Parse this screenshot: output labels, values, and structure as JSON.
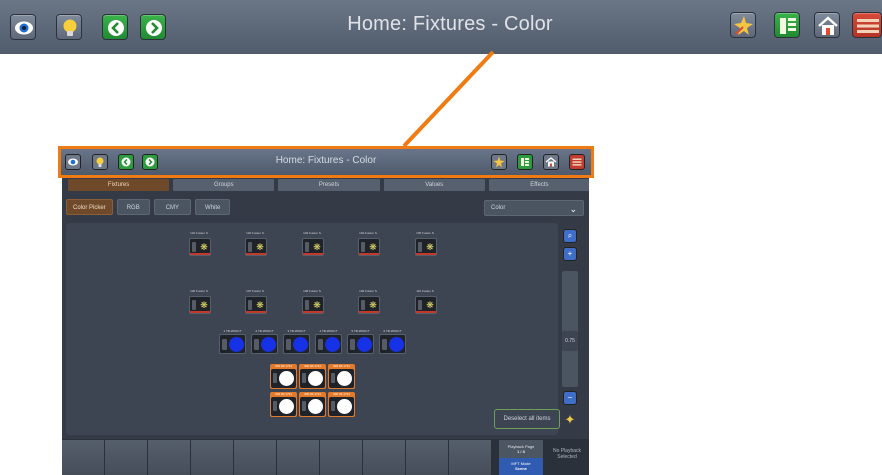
{
  "colors": {
    "accent": "#f07b12",
    "bar": "#5d6879",
    "tab_active": "#6e4a2a",
    "tilebar_dot": "#1732e6"
  },
  "header": {
    "title": "Home: Fixtures - Color",
    "left_icons": [
      "eye-icon",
      "lightbulb-icon",
      "back-arrow-icon",
      "forward-arrow-icon"
    ],
    "right_icons": [
      "sparkle-icon",
      "layout-grid-icon",
      "home-icon",
      "menu-icon"
    ]
  },
  "mini": {
    "title": "Home: Fixtures - Color",
    "tabs": [
      "Fixtures",
      "Groups",
      "Presets",
      "Values",
      "Effects"
    ],
    "active_tab": "Fixtures",
    "subtabs": [
      "Color Picker",
      "RGB",
      "CMY",
      "White"
    ],
    "active_subtab": "Color Picker",
    "dropdown": "Color",
    "fixtures_row1": [
      "101 Fusion S",
      "102 Fusion S",
      "103 Fusion S",
      "104 Fusion S",
      "105 Fusion S"
    ],
    "fixtures_row2": [
      "106 Fusion S",
      "107 Fusion S",
      "108 Fusion S",
      "109 Fusion S",
      "110 Fusion S"
    ],
    "tilebars": [
      "1 TB-3500CT",
      "2 TB-3500CT",
      "3 TB-3500CT",
      "4 TB-3500CT",
      "5 TB-3500CT",
      "6 TB-3500CT"
    ],
    "color_row1": [
      "301 4K 1711",
      "302 4K 1711",
      "303 4K 1711"
    ],
    "color_row2": [
      "304 4K 1711",
      "305 4K 1711",
      "306 4K 1711"
    ],
    "slider_value": "0.75",
    "deselect": "Deselect all items",
    "playback": {
      "page_label": "Playback Page",
      "page_value": "1 / 8",
      "mft_label": "MFT Mode",
      "mft_value": "Scene"
    },
    "no_playback": "No Playback Selected"
  }
}
